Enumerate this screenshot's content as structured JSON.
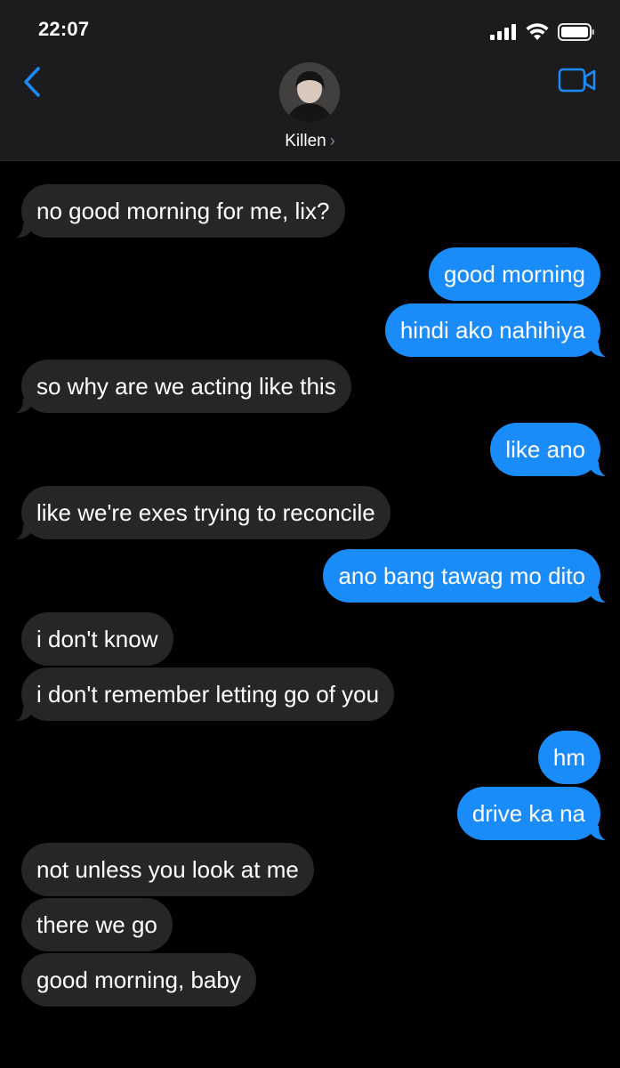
{
  "status_bar": {
    "time": "22:07"
  },
  "header": {
    "contact_name": "Killen"
  },
  "colors": {
    "accent": "#1a8cfa",
    "incoming_bubble": "#262628",
    "header_bg": "#1c1c1e"
  },
  "messages": [
    {
      "direction": "incoming",
      "text": "no good morning for me, lix?",
      "tail": true
    },
    {
      "direction": "outgoing",
      "text": "good morning",
      "tail": false
    },
    {
      "direction": "outgoing",
      "text": "hindi ako nahihiya",
      "tail": true
    },
    {
      "direction": "incoming",
      "text": "so why are we acting like this",
      "tail": true
    },
    {
      "direction": "outgoing",
      "text": "like ano",
      "tail": true
    },
    {
      "direction": "incoming",
      "text": "like we're exes trying to reconcile",
      "tail": true
    },
    {
      "direction": "outgoing",
      "text": "ano bang tawag mo dito",
      "tail": true
    },
    {
      "direction": "incoming",
      "text": "i don't know",
      "tail": false
    },
    {
      "direction": "incoming",
      "text": "i don't remember letting go of you",
      "tail": true
    },
    {
      "direction": "outgoing",
      "text": "hm",
      "tail": false
    },
    {
      "direction": "outgoing",
      "text": "drive ka na",
      "tail": true
    },
    {
      "direction": "incoming",
      "text": "not unless you look at me",
      "tail": false
    },
    {
      "direction": "incoming",
      "text": "there we go",
      "tail": false
    },
    {
      "direction": "incoming",
      "text": "good morning, baby",
      "tail": false
    }
  ]
}
